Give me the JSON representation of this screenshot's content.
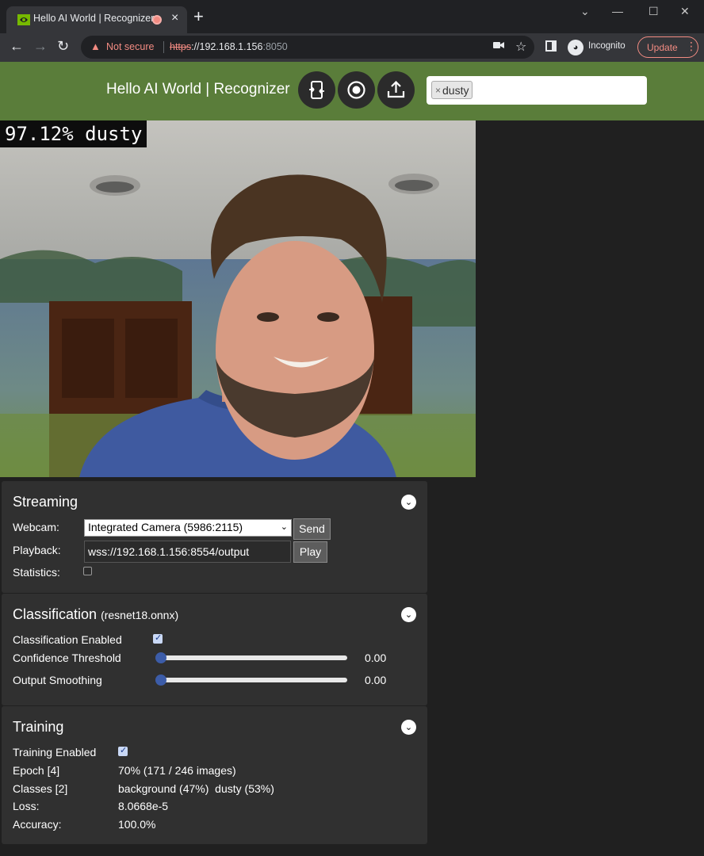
{
  "browser": {
    "tab_title": "Hello AI World | Recognizer",
    "security_label": "Not secure",
    "url_scheme": "https",
    "url_host": "://192.168.1.156",
    "url_port": ":8050",
    "profile_label": "Incognito",
    "update_label": "Update"
  },
  "app": {
    "title": "Hello AI World | Recognizer",
    "buttons": [
      "switch-camera-icon",
      "record-icon",
      "upload-icon"
    ],
    "tags": [
      {
        "label": "dusty",
        "remove": "×"
      }
    ],
    "accent_color": "#5a7d3a"
  },
  "video": {
    "overlay_text": "97.12% dusty"
  },
  "streaming": {
    "title": "Streaming",
    "webcam_label": "Webcam:",
    "webcam_value": "Integrated Camera (5986:2115)",
    "send_label": "Send",
    "playback_label": "Playback:",
    "playback_value": "wss://192.168.1.156:8554/output",
    "play_label": "Play",
    "statistics_label": "Statistics:",
    "statistics_checked": false
  },
  "classification": {
    "title": "Classification",
    "model": "(resnet18.onnx)",
    "enabled_label": "Classification Enabled",
    "enabled": true,
    "threshold_label": "Confidence Threshold",
    "threshold_value": "0.00",
    "threshold_fraction": 0.0,
    "smoothing_label": "Output Smoothing",
    "smoothing_value": "0.00",
    "smoothing_fraction": 0.0
  },
  "training": {
    "title": "Training",
    "enabled_label": "Training Enabled",
    "enabled": true,
    "epoch_label": "Epoch [4]",
    "epoch_value": "70% (171 / 246 images)",
    "classes_label": "Classes [2]",
    "classes_value": "background (47%)  dusty (53%)",
    "loss_label": "Loss:",
    "loss_value": "8.0668e-5",
    "accuracy_label": "Accuracy:",
    "accuracy_value": "100.0%"
  }
}
